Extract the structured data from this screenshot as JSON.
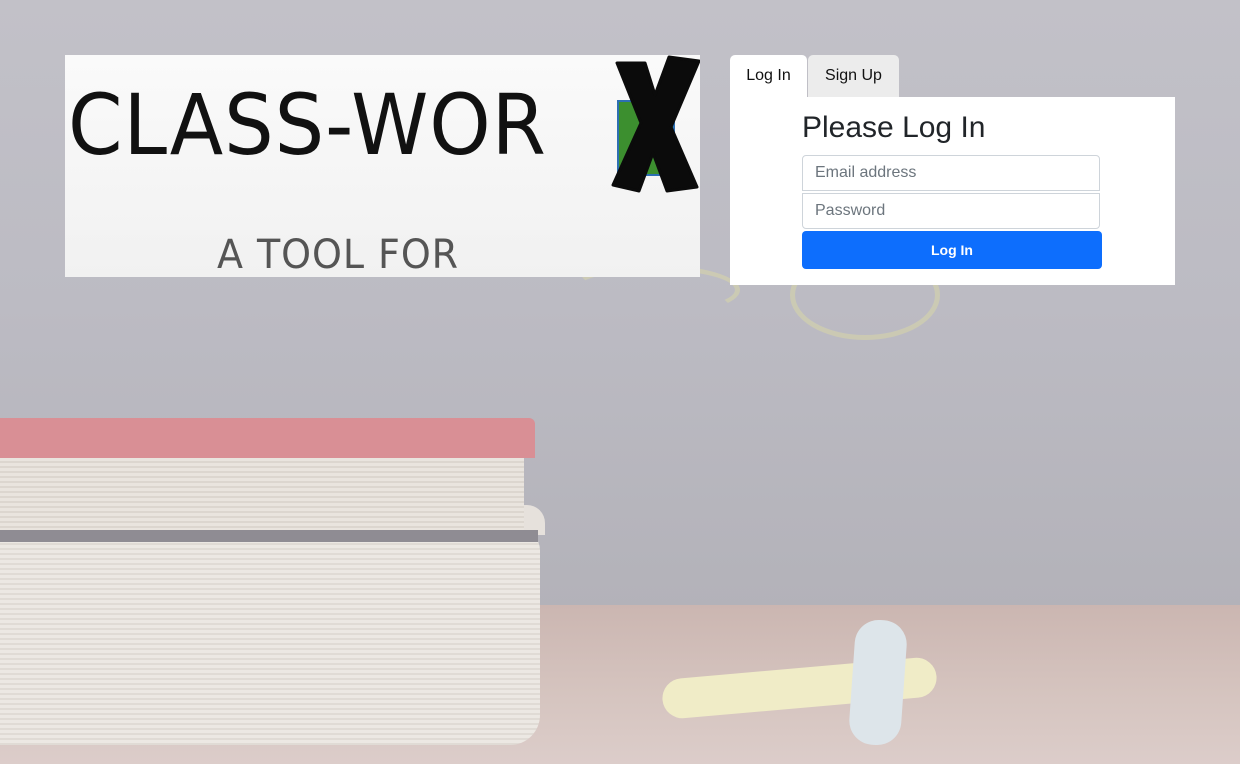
{
  "logo": {
    "main_text": "CLASS-WOR",
    "tagline": "A TOOL FOR TEACHERS"
  },
  "tabs": [
    {
      "label": "Log In",
      "active": true
    },
    {
      "label": "Sign Up",
      "active": false
    }
  ],
  "login": {
    "heading": "Please Log In",
    "email_placeholder": "Email address",
    "password_placeholder": "Password",
    "submit_label": "Log In"
  },
  "colors": {
    "primary_button": "#0d6efd",
    "logo_green": "#3c8f2f"
  }
}
